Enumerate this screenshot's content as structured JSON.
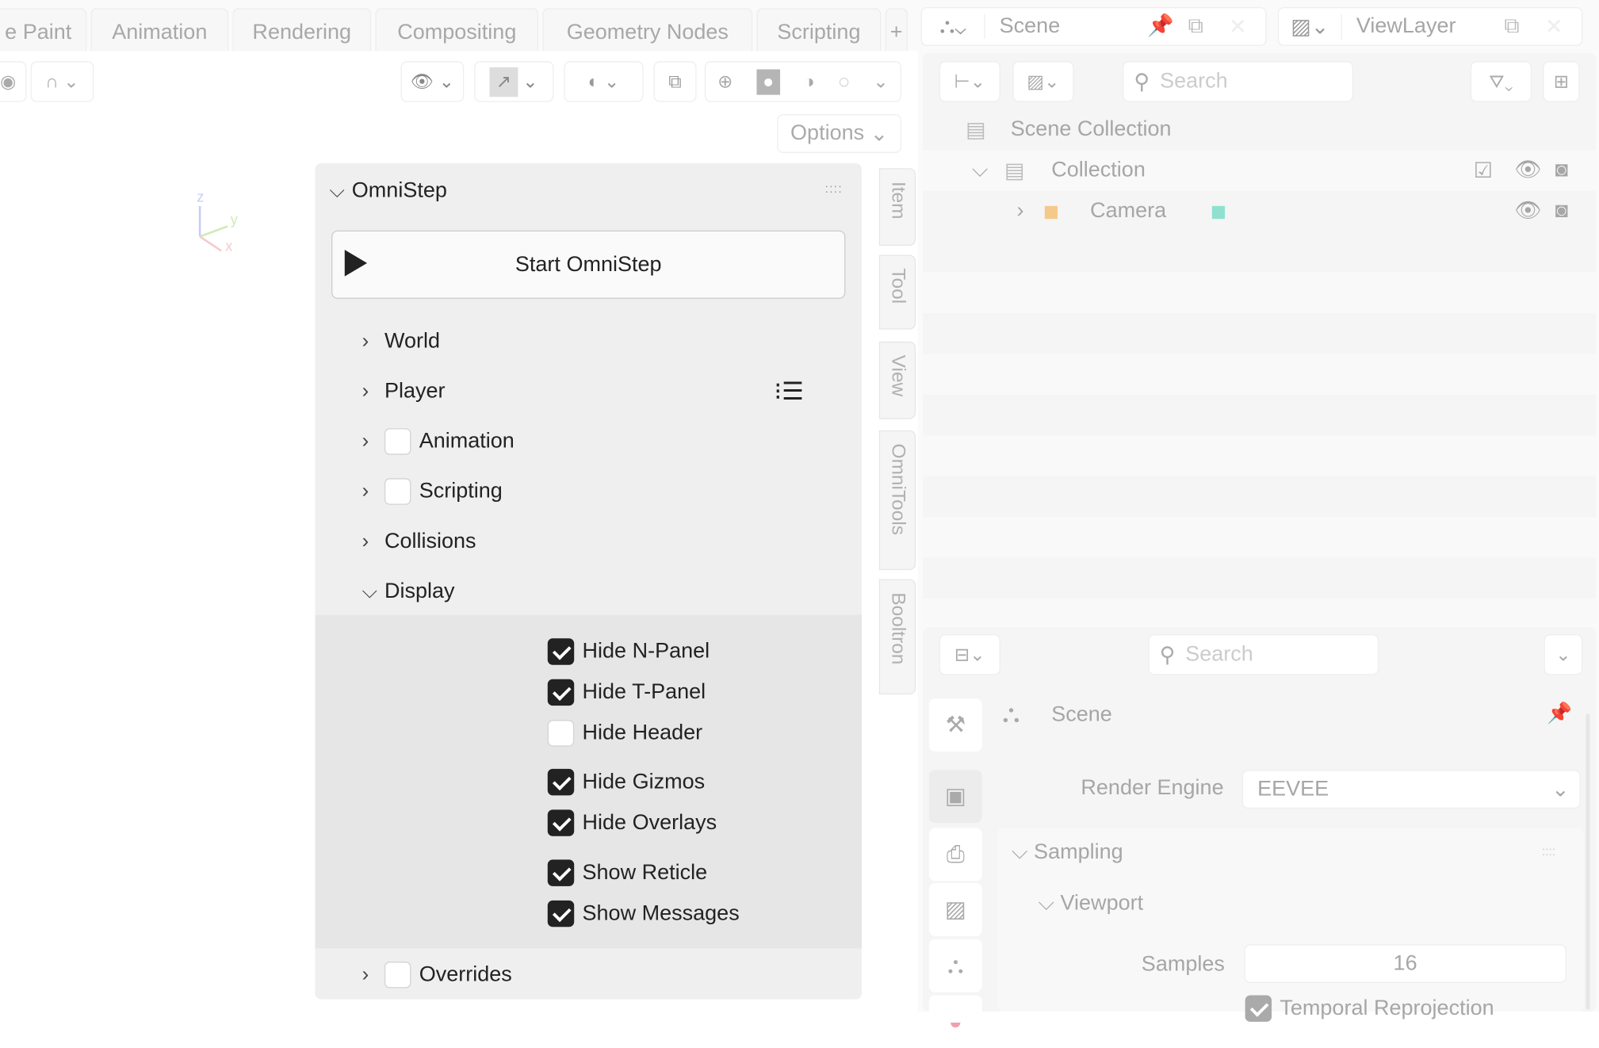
{
  "workspace_tabs": [
    "e Paint",
    "Animation",
    "Rendering",
    "Compositing",
    "Geometry Nodes",
    "Scripting",
    "+"
  ],
  "viewport": {
    "options_label": "Options",
    "axes": {
      "z": "z",
      "y": "y",
      "x": "x"
    }
  },
  "npanel": {
    "title": "OmniStep",
    "start_button": "Start OmniStep",
    "sections": [
      {
        "label": "World"
      },
      {
        "label": "Player"
      },
      {
        "label": "Animation",
        "checked": false
      },
      {
        "label": "Scripting",
        "checked": false
      },
      {
        "label": "Collisions"
      },
      {
        "label": "Display",
        "expanded": true
      }
    ],
    "display_options": [
      {
        "label": "Hide N-Panel",
        "checked": true
      },
      {
        "label": "Hide T-Panel",
        "checked": true
      },
      {
        "label": "Hide Header",
        "checked": false
      },
      {
        "label": "Hide Gizmos",
        "checked": true
      },
      {
        "label": "Hide Overlays",
        "checked": true
      },
      {
        "label": "Show Reticle",
        "checked": true
      },
      {
        "label": "Show Messages",
        "checked": true
      }
    ],
    "overrides": {
      "label": "Overrides",
      "checked": false
    }
  },
  "sidebar_tabs": [
    "Item",
    "Tool",
    "View",
    "OmniTools",
    "Booltron"
  ],
  "scene_selector": {
    "scene": "Scene",
    "view_layer": "ViewLayer"
  },
  "outliner": {
    "search_placeholder": "Search",
    "items": [
      {
        "label": "Scene Collection"
      },
      {
        "label": "Collection",
        "checked": true
      },
      {
        "label": "Camera"
      }
    ]
  },
  "properties": {
    "search_placeholder": "Search",
    "context": "Scene",
    "render_engine_label": "Render Engine",
    "render_engine": "EEVEE",
    "sampling": "Sampling",
    "viewport": "Viewport",
    "samples_label": "Samples",
    "samples": "16",
    "temporal_reprojection": "Temporal Reprojection"
  },
  "colors": {
    "camera_icon": "#f5c98a",
    "camera_data_icon": "#8fe0cf",
    "panel_bg": "#efefef"
  }
}
